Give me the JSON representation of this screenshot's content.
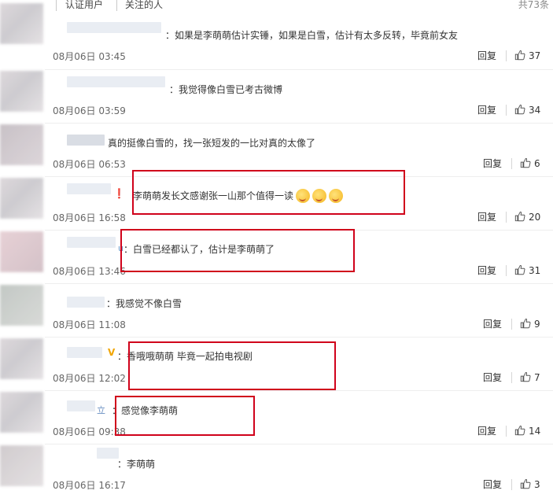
{
  "tabs": {
    "verified_users": "认证用户",
    "followed_users": "关注的人",
    "total": "共73条"
  },
  "labels": {
    "reply": "回复"
  },
  "colors": {
    "highlight_box": "#d0021b",
    "vip_badge": "#f0a500"
  },
  "icons": {
    "like": "thumbs-up-icon",
    "vip": "vip-v-icon",
    "emoji": "face-savoring-food-icon"
  },
  "comments": [
    {
      "text": "如果是李萌萌估计实锤，如果是白雪，估计有太多反转，毕竟前女友",
      "date": "08月06日 03:45",
      "likes": "37",
      "highlighted": false
    },
    {
      "text": "我觉得像白雪已考古微博",
      "date": "08月06日 03:59",
      "likes": "34",
      "highlighted": false
    },
    {
      "text": "真的挺像白雪的，找一张短发的一比对真的太像了",
      "date": "08月06日 06:53",
      "likes": "6",
      "highlighted": false
    },
    {
      "text": "李萌萌发长文感谢张一山那个值得一读",
      "date": "08月06日 16:58",
      "likes": "20",
      "highlighted": true
    },
    {
      "text": "白雪已经都认了，估计是李萌萌了",
      "date": "08月06日 13:46",
      "likes": "31",
      "highlighted": true
    },
    {
      "text": "我感觉不像白雪",
      "date": "08月06日 11:08",
      "likes": "9",
      "highlighted": false
    },
    {
      "text": "香哦哦萌萌 毕竟一起拍电视剧",
      "date": "08月06日 12:02",
      "likes": "7",
      "highlighted": true
    },
    {
      "text": "感觉像李萌萌",
      "date": "08月06日 09:38",
      "likes": "14",
      "highlighted": true
    },
    {
      "text": "李萌萌",
      "date": "08月06日 16:17",
      "likes": "3",
      "highlighted": false
    }
  ]
}
